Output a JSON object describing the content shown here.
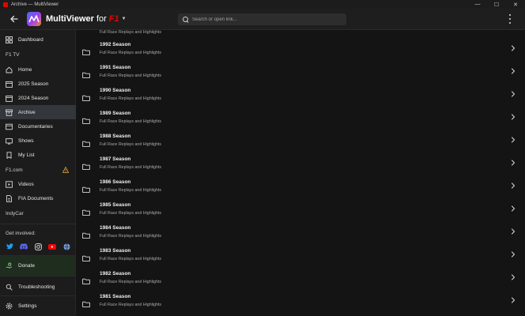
{
  "window": {
    "title": "Archive — MultiViewer",
    "controls": {
      "minimize": "—",
      "maximize": "☐",
      "close": "✕"
    }
  },
  "header": {
    "app_name": "MultiViewer",
    "app_for": "for",
    "brand": "F1",
    "search_placeholder": "Search or open link..."
  },
  "sidebar": {
    "dashboard": "Dashboard",
    "f1tv_heading": "F1 TV",
    "f1tv_items": [
      "Home",
      "2025 Season",
      "2024 Season",
      "Archive",
      "Documentaries",
      "Shows",
      "My List"
    ],
    "f1com_heading": "F1.com",
    "f1com_items": [
      "Videos",
      "FIA Documents"
    ],
    "indycar_heading": "IndyCar",
    "get_involved_heading": "Get involved:",
    "donate": "Donate",
    "troubleshooting": "Troubleshooting",
    "settings": "Settings",
    "active_item": "Archive",
    "colors": {
      "twitter": "#1d9bf0",
      "discord": "#5865f2",
      "instagram": "#e6e6e6",
      "youtube": "#ff0000",
      "web": "#7aa7e8",
      "warning": "#e8a33a"
    }
  },
  "archive": {
    "partial_top_subtitle": "Full Race Replays and Highlights",
    "seasons": [
      {
        "title": "1992 Season",
        "subtitle": "Full Race Replays and Highlights"
      },
      {
        "title": "1991 Season",
        "subtitle": "Full Race Replays and Highlights"
      },
      {
        "title": "1990 Season",
        "subtitle": "Full Race Replays and Highlights"
      },
      {
        "title": "1989 Season",
        "subtitle": "Full Race Replays and Highlights"
      },
      {
        "title": "1988 Season",
        "subtitle": "Full Race Replays and Highlights"
      },
      {
        "title": "1987 Season",
        "subtitle": "Full Race Replays and Highlights"
      },
      {
        "title": "1986 Season",
        "subtitle": "Full Race Replays and Highlights"
      },
      {
        "title": "1985 Season",
        "subtitle": "Full Race Replays and Highlights"
      },
      {
        "title": "1984 Season",
        "subtitle": "Full Race Replays and Highlights"
      },
      {
        "title": "1983 Season",
        "subtitle": "Full Race Replays and Highlights"
      },
      {
        "title": "1982 Season",
        "subtitle": "Full Race Replays and Highlights"
      },
      {
        "title": "1981 Season",
        "subtitle": "Full Race Replays and Highlights"
      }
    ]
  }
}
